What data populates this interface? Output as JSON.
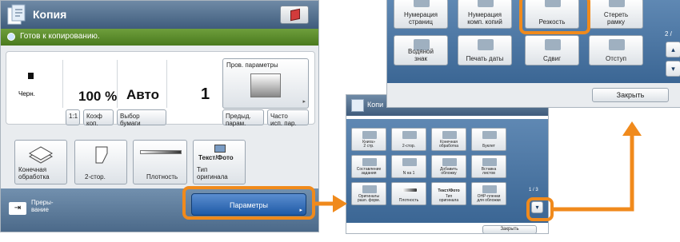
{
  "screen1": {
    "title": "Копия",
    "status": "Готов к копированию.",
    "color_mode": "Черн.",
    "ratio": "100 %",
    "paper": "Авто",
    "copies": "1",
    "btn_1to1": "1:1",
    "btn_koef": "Коэф\nкоп.",
    "btn_vybor": "Выбор\nбумаги",
    "btn_prov": "Пров. параметры",
    "btn_predyd": "Предыд.\nпарам.",
    "btn_chasto": "Часто\nисп. пар.",
    "func_konechnaya": "Конечная\nобработка",
    "func_2stor": "2-стор.",
    "func_plotnost": "Плотность",
    "func_textfoto": "Текст/Фото",
    "func_tip": "Тип\nоригинала",
    "btn_preryvanie": "Преры-\nвание",
    "btn_parametry": "Параметры"
  },
  "screen2": {
    "title": "Копи",
    "options": [
      "Книга»\n2 стр.",
      "2-стор.",
      "Конечная\nобработка",
      "Буклет",
      "Составление\nзадания",
      "N на 1",
      "Добавить\nобложку",
      "Вставка\nлистов",
      "Оригиналы\nразл. форм.",
      "Плотность",
      "Тип\nоригинала",
      "OHP-пленки\nдля обложки"
    ],
    "text_foto": "Текст/Фото",
    "page": "1 / 3",
    "close": "Закрыть"
  },
  "screen3": {
    "row1": [
      "Нумерация\nстраниц",
      "Нумерация\nкомп. копий",
      "Резкость",
      "Стереть\nрамку"
    ],
    "row2": [
      "Водяной\nзнак",
      "Печать даты",
      "Сдвиг",
      "Отступ"
    ],
    "page": "2 /",
    "close": "Закрыть"
  },
  "colors": {
    "highlight": "#f08a1c",
    "titlebar": "#4f6d8f",
    "status": "#5a8a2c",
    "accent_button": "#2f6bb8"
  }
}
